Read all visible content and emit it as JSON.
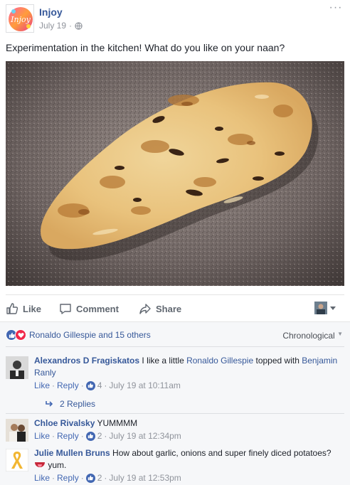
{
  "post": {
    "page_name": "Injoy",
    "avatar_text": "Injoy",
    "date": "July 19",
    "more_label": "···",
    "text": "Experimentation in the kitchen! What do you like on your naan?"
  },
  "actions": {
    "like": "Like",
    "comment": "Comment",
    "share": "Share"
  },
  "reactions": {
    "summary": "Ronaldo Gillespie and 15 others",
    "sort_label": "Chronological"
  },
  "comments": [
    {
      "author": "Alexandros D Fragiskatos",
      "text_before": " I like a little ",
      "mention1": "Ronaldo Gillespie",
      "text_middle": " topped with ",
      "mention2": "Benjamin Ranly",
      "like": "Like",
      "reply": "Reply",
      "like_count": "4",
      "time": "July 19 at 10:11am",
      "replies": "2 Replies"
    },
    {
      "author": "Chloe Rivalsky",
      "text": " YUMMMM",
      "like": "Like",
      "reply": "Reply",
      "like_count": "2",
      "time": "July 19 at 12:34pm"
    },
    {
      "author": "Julie Mullen Bruns",
      "text": " How about garlic, onions and super finely diced potatoes?",
      "text2": " yum.",
      "like": "Like",
      "reply": "Reply",
      "like_count": "2",
      "time": "July 19 at 12:53pm"
    }
  ],
  "colors": {
    "link": "#365899",
    "accent": "#4267b2",
    "love": "#f0284a",
    "muted": "#90949c"
  },
  "icons": [
    "globe-icon",
    "more-icon",
    "thumbs-up-icon",
    "comment-icon",
    "share-icon",
    "like-reaction-icon",
    "love-reaction-icon",
    "reply-arrow-icon",
    "ribbon-icon"
  ]
}
